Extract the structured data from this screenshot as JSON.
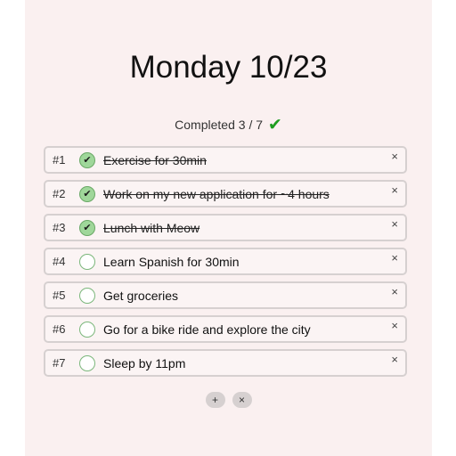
{
  "header": {
    "title": "Monday 10/23"
  },
  "summary": {
    "prefix": "Completed",
    "completed": "3",
    "separator": "/",
    "total": "7",
    "check_icon": "✔"
  },
  "tasks": [
    {
      "number": "#1",
      "label": "Exercise for 30min",
      "done": true
    },
    {
      "number": "#2",
      "label": "Work on my new application for ~4 hours",
      "done": true
    },
    {
      "number": "#3",
      "label": "Lunch with Meow",
      "done": true
    },
    {
      "number": "#4",
      "label": "Learn Spanish for 30min",
      "done": false
    },
    {
      "number": "#5",
      "label": "Get groceries",
      "done": false
    },
    {
      "number": "#6",
      "label": "Go for a bike ride and explore the city",
      "done": false
    },
    {
      "number": "#7",
      "label": "Sleep by 11pm",
      "done": false
    }
  ],
  "icons": {
    "checkmark": "✔",
    "close": "×",
    "add": "+",
    "clear": "×"
  },
  "colors": {
    "accent_green": "#1f9d1f",
    "done_circle": "#9fd79a",
    "background": "#faf0f0"
  }
}
